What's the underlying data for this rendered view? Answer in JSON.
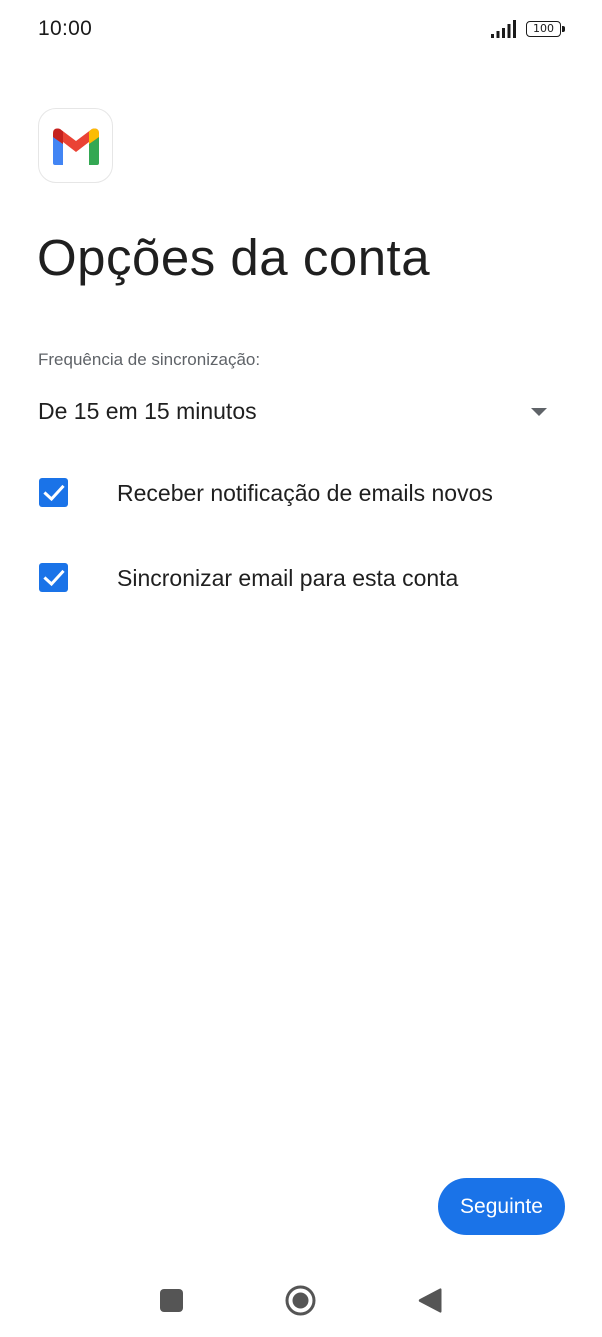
{
  "status_bar": {
    "time": "10:00",
    "battery": "100",
    "icons": [
      "signal-icon",
      "battery-icon"
    ]
  },
  "app": {
    "logo_icon": "gmail-logo-icon",
    "title": "Opções da conta"
  },
  "sync": {
    "label": "Frequência de sincronização:",
    "selected": "De 15 em 15 minutos",
    "icon": "dropdown-arrow-icon"
  },
  "options": [
    {
      "label": "Receber notificação de emails novos",
      "checked": true
    },
    {
      "label": "Sincronizar email para esta conta",
      "checked": true
    }
  ],
  "actions": {
    "next_label": "Seguinte"
  },
  "nav": {
    "icons": [
      "recents-icon",
      "home-icon",
      "back-icon"
    ]
  },
  "colors": {
    "accent": "#1a73e8",
    "text": "#1f1f1f",
    "secondary_text": "#5f6368"
  }
}
